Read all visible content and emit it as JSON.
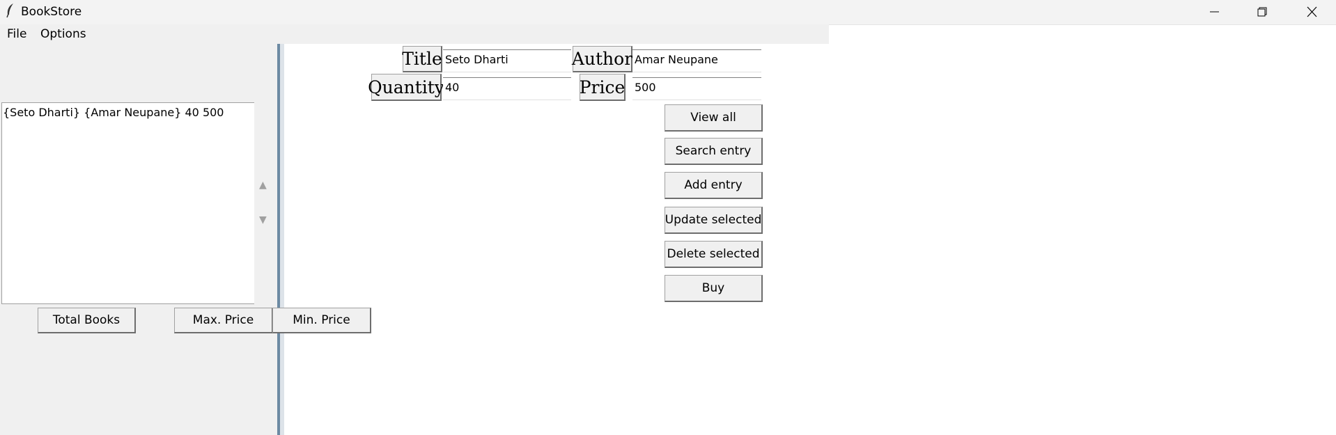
{
  "window": {
    "title": "BookStore",
    "controls": {
      "minimize": "minimize-icon",
      "restore": "restore-icon",
      "close": "close-icon"
    }
  },
  "menu": {
    "file": "File",
    "options": "Options"
  },
  "form": {
    "title_label": "Title",
    "title_value": "Seto Dharti",
    "author_label": "Author",
    "author_value": "Amar Neupane",
    "quantity_label": "Quantity",
    "quantity_value": "40",
    "price_label": "Price",
    "price_value": "500"
  },
  "actions": {
    "view_all": "View all",
    "search_entry": "Search entry",
    "add_entry": "Add entry",
    "update_selected": "Update selected",
    "delete_selected": "Delete selected",
    "buy": "Buy"
  },
  "listbox": {
    "rows": [
      "{Seto Dharti} {Amar Neupane} 40 500"
    ]
  },
  "stats": {
    "total_books": "Total Books",
    "max_price": "Max. Price",
    "min_price": "Min. Price"
  }
}
